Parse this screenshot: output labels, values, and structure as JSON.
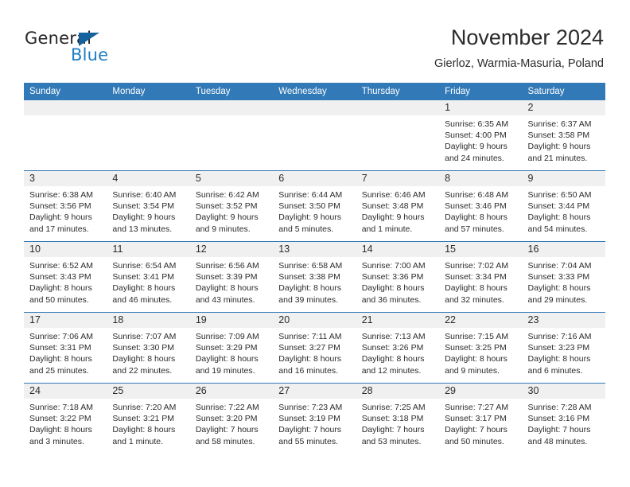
{
  "brand": {
    "word_general": "General",
    "word_blue": "Blue",
    "triangle_color": "#14639e"
  },
  "header": {
    "title": "November 2024",
    "subtitle": "Gierloz, Warmia-Masuria, Poland"
  },
  "theme": {
    "header_blue": "#3279b7",
    "daynum_gray": "#f0f0f0",
    "text": "#2b2b2b"
  },
  "weekdays": [
    "Sunday",
    "Monday",
    "Tuesday",
    "Wednesday",
    "Thursday",
    "Friday",
    "Saturday"
  ],
  "weeks": [
    [
      {
        "day": "",
        "sunrise": "",
        "sunset": "",
        "daylight1": "",
        "daylight2": ""
      },
      {
        "day": "",
        "sunrise": "",
        "sunset": "",
        "daylight1": "",
        "daylight2": ""
      },
      {
        "day": "",
        "sunrise": "",
        "sunset": "",
        "daylight1": "",
        "daylight2": ""
      },
      {
        "day": "",
        "sunrise": "",
        "sunset": "",
        "daylight1": "",
        "daylight2": ""
      },
      {
        "day": "",
        "sunrise": "",
        "sunset": "",
        "daylight1": "",
        "daylight2": ""
      },
      {
        "day": "1",
        "sunrise": "Sunrise: 6:35 AM",
        "sunset": "Sunset: 4:00 PM",
        "daylight1": "Daylight: 9 hours",
        "daylight2": "and 24 minutes."
      },
      {
        "day": "2",
        "sunrise": "Sunrise: 6:37 AM",
        "sunset": "Sunset: 3:58 PM",
        "daylight1": "Daylight: 9 hours",
        "daylight2": "and 21 minutes."
      }
    ],
    [
      {
        "day": "3",
        "sunrise": "Sunrise: 6:38 AM",
        "sunset": "Sunset: 3:56 PM",
        "daylight1": "Daylight: 9 hours",
        "daylight2": "and 17 minutes."
      },
      {
        "day": "4",
        "sunrise": "Sunrise: 6:40 AM",
        "sunset": "Sunset: 3:54 PM",
        "daylight1": "Daylight: 9 hours",
        "daylight2": "and 13 minutes."
      },
      {
        "day": "5",
        "sunrise": "Sunrise: 6:42 AM",
        "sunset": "Sunset: 3:52 PM",
        "daylight1": "Daylight: 9 hours",
        "daylight2": "and 9 minutes."
      },
      {
        "day": "6",
        "sunrise": "Sunrise: 6:44 AM",
        "sunset": "Sunset: 3:50 PM",
        "daylight1": "Daylight: 9 hours",
        "daylight2": "and 5 minutes."
      },
      {
        "day": "7",
        "sunrise": "Sunrise: 6:46 AM",
        "sunset": "Sunset: 3:48 PM",
        "daylight1": "Daylight: 9 hours",
        "daylight2": "and 1 minute."
      },
      {
        "day": "8",
        "sunrise": "Sunrise: 6:48 AM",
        "sunset": "Sunset: 3:46 PM",
        "daylight1": "Daylight: 8 hours",
        "daylight2": "and 57 minutes."
      },
      {
        "day": "9",
        "sunrise": "Sunrise: 6:50 AM",
        "sunset": "Sunset: 3:44 PM",
        "daylight1": "Daylight: 8 hours",
        "daylight2": "and 54 minutes."
      }
    ],
    [
      {
        "day": "10",
        "sunrise": "Sunrise: 6:52 AM",
        "sunset": "Sunset: 3:43 PM",
        "daylight1": "Daylight: 8 hours",
        "daylight2": "and 50 minutes."
      },
      {
        "day": "11",
        "sunrise": "Sunrise: 6:54 AM",
        "sunset": "Sunset: 3:41 PM",
        "daylight1": "Daylight: 8 hours",
        "daylight2": "and 46 minutes."
      },
      {
        "day": "12",
        "sunrise": "Sunrise: 6:56 AM",
        "sunset": "Sunset: 3:39 PM",
        "daylight1": "Daylight: 8 hours",
        "daylight2": "and 43 minutes."
      },
      {
        "day": "13",
        "sunrise": "Sunrise: 6:58 AM",
        "sunset": "Sunset: 3:38 PM",
        "daylight1": "Daylight: 8 hours",
        "daylight2": "and 39 minutes."
      },
      {
        "day": "14",
        "sunrise": "Sunrise: 7:00 AM",
        "sunset": "Sunset: 3:36 PM",
        "daylight1": "Daylight: 8 hours",
        "daylight2": "and 36 minutes."
      },
      {
        "day": "15",
        "sunrise": "Sunrise: 7:02 AM",
        "sunset": "Sunset: 3:34 PM",
        "daylight1": "Daylight: 8 hours",
        "daylight2": "and 32 minutes."
      },
      {
        "day": "16",
        "sunrise": "Sunrise: 7:04 AM",
        "sunset": "Sunset: 3:33 PM",
        "daylight1": "Daylight: 8 hours",
        "daylight2": "and 29 minutes."
      }
    ],
    [
      {
        "day": "17",
        "sunrise": "Sunrise: 7:06 AM",
        "sunset": "Sunset: 3:31 PM",
        "daylight1": "Daylight: 8 hours",
        "daylight2": "and 25 minutes."
      },
      {
        "day": "18",
        "sunrise": "Sunrise: 7:07 AM",
        "sunset": "Sunset: 3:30 PM",
        "daylight1": "Daylight: 8 hours",
        "daylight2": "and 22 minutes."
      },
      {
        "day": "19",
        "sunrise": "Sunrise: 7:09 AM",
        "sunset": "Sunset: 3:29 PM",
        "daylight1": "Daylight: 8 hours",
        "daylight2": "and 19 minutes."
      },
      {
        "day": "20",
        "sunrise": "Sunrise: 7:11 AM",
        "sunset": "Sunset: 3:27 PM",
        "daylight1": "Daylight: 8 hours",
        "daylight2": "and 16 minutes."
      },
      {
        "day": "21",
        "sunrise": "Sunrise: 7:13 AM",
        "sunset": "Sunset: 3:26 PM",
        "daylight1": "Daylight: 8 hours",
        "daylight2": "and 12 minutes."
      },
      {
        "day": "22",
        "sunrise": "Sunrise: 7:15 AM",
        "sunset": "Sunset: 3:25 PM",
        "daylight1": "Daylight: 8 hours",
        "daylight2": "and 9 minutes."
      },
      {
        "day": "23",
        "sunrise": "Sunrise: 7:16 AM",
        "sunset": "Sunset: 3:23 PM",
        "daylight1": "Daylight: 8 hours",
        "daylight2": "and 6 minutes."
      }
    ],
    [
      {
        "day": "24",
        "sunrise": "Sunrise: 7:18 AM",
        "sunset": "Sunset: 3:22 PM",
        "daylight1": "Daylight: 8 hours",
        "daylight2": "and 3 minutes."
      },
      {
        "day": "25",
        "sunrise": "Sunrise: 7:20 AM",
        "sunset": "Sunset: 3:21 PM",
        "daylight1": "Daylight: 8 hours",
        "daylight2": "and 1 minute."
      },
      {
        "day": "26",
        "sunrise": "Sunrise: 7:22 AM",
        "sunset": "Sunset: 3:20 PM",
        "daylight1": "Daylight: 7 hours",
        "daylight2": "and 58 minutes."
      },
      {
        "day": "27",
        "sunrise": "Sunrise: 7:23 AM",
        "sunset": "Sunset: 3:19 PM",
        "daylight1": "Daylight: 7 hours",
        "daylight2": "and 55 minutes."
      },
      {
        "day": "28",
        "sunrise": "Sunrise: 7:25 AM",
        "sunset": "Sunset: 3:18 PM",
        "daylight1": "Daylight: 7 hours",
        "daylight2": "and 53 minutes."
      },
      {
        "day": "29",
        "sunrise": "Sunrise: 7:27 AM",
        "sunset": "Sunset: 3:17 PM",
        "daylight1": "Daylight: 7 hours",
        "daylight2": "and 50 minutes."
      },
      {
        "day": "30",
        "sunrise": "Sunrise: 7:28 AM",
        "sunset": "Sunset: 3:16 PM",
        "daylight1": "Daylight: 7 hours",
        "daylight2": "and 48 minutes."
      }
    ]
  ]
}
